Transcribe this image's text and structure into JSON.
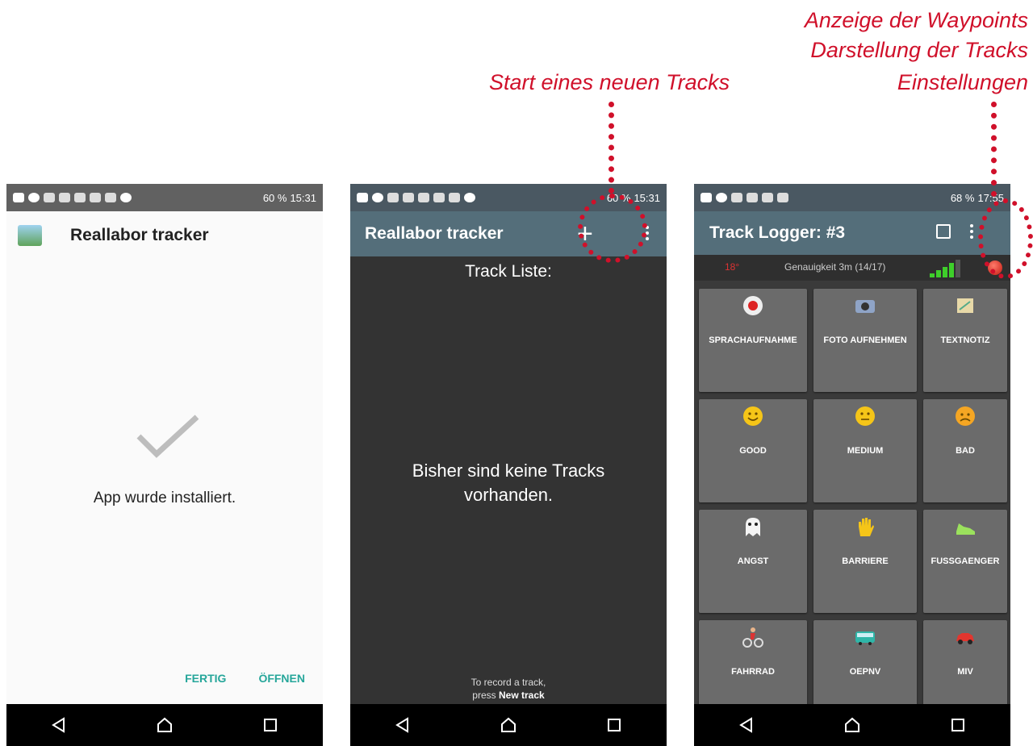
{
  "annotations": {
    "new_track": "Start eines neuen Tracks",
    "menu_line1": "Anzeige der Waypoints",
    "menu_line2": "Darstellung der Tracks",
    "menu_line3": "Einstellungen",
    "color": "#d0102a"
  },
  "phone1": {
    "status_time": "15:31",
    "status_battery": "60 %",
    "app_title": "Reallabor tracker",
    "message": "App wurde installiert.",
    "done_button": "FERTIG",
    "open_button": "ÖFFNEN",
    "accent": "#26a69a"
  },
  "phone2": {
    "status_time": "15:31",
    "status_battery": "60 %",
    "toolbar_title": "Reallabor tracker",
    "list_header": "Track Liste:",
    "empty_message": "Bisher sind keine Tracks vorhanden.",
    "hint_line1": "To record a track,",
    "hint_prefix": "press ",
    "hint_action": "New track"
  },
  "phone3": {
    "status_time": "17:55",
    "status_battery": "68 %",
    "toolbar_title": "Track Logger: #3",
    "accuracy_text": "Genauigkeit 3m (14/17)",
    "red_indicator": "18°",
    "tiles": [
      {
        "label": "SPRACHAUFNAHME",
        "icon": "microphone-record-icon"
      },
      {
        "label": "FOTO AUFNEHMEN",
        "icon": "camera-icon"
      },
      {
        "label": "TEXTNOTIZ",
        "icon": "note-icon"
      },
      {
        "label": "GOOD",
        "icon": "smile-icon"
      },
      {
        "label": "MEDIUM",
        "icon": "neutral-face-icon"
      },
      {
        "label": "BAD",
        "icon": "sad-face-icon"
      },
      {
        "label": "ANGST",
        "icon": "ghost-icon"
      },
      {
        "label": "BARRIERE",
        "icon": "hand-icon"
      },
      {
        "label": "FUSSGAENGER",
        "icon": "shoe-icon"
      },
      {
        "label": "FAHRRAD",
        "icon": "cyclist-icon"
      },
      {
        "label": "OEPNV",
        "icon": "bus-icon"
      },
      {
        "label": "MIV",
        "icon": "car-icon"
      }
    ]
  }
}
